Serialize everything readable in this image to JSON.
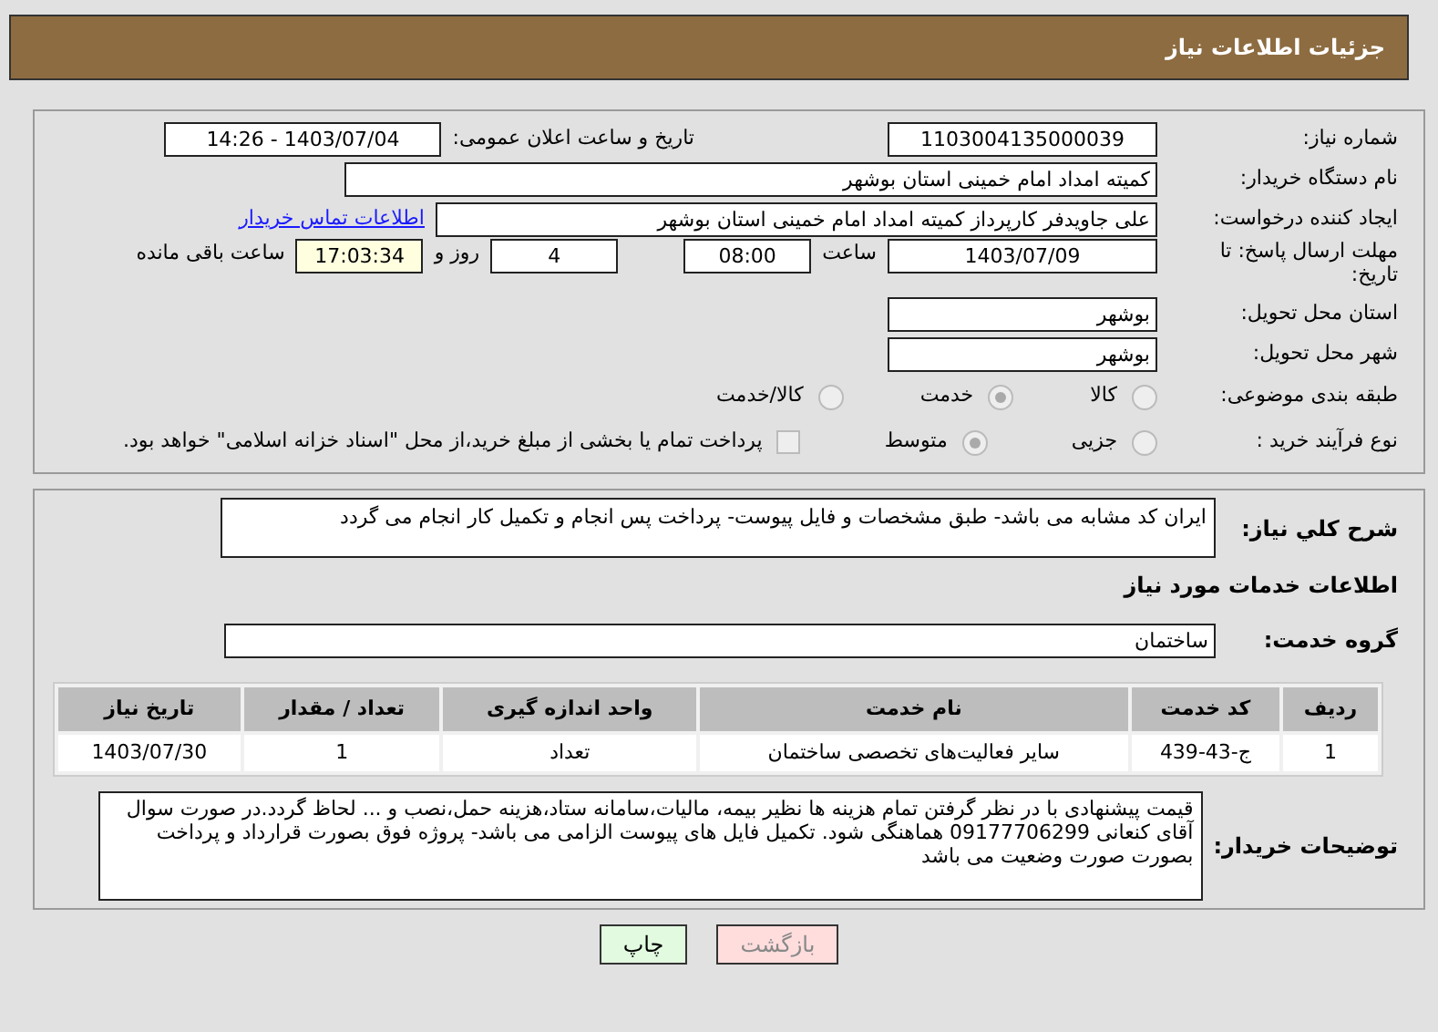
{
  "header": {
    "title": "جزئیات اطلاعات نیاز"
  },
  "need_number": {
    "label": "شماره نیاز:",
    "value": "1103004135000039"
  },
  "announce_date": {
    "label": "تاریخ و ساعت اعلان عمومی:",
    "value": "1403/07/04 - 14:26"
  },
  "buyer_org": {
    "label": "نام دستگاه خریدار:",
    "value": "کمیته امداد امام خمینی استان بوشهر"
  },
  "requester": {
    "label": "ایجاد کننده درخواست:",
    "value": "علی جاویدفر کارپرداز کمیته امداد امام خمینی استان بوشهر",
    "link": "اطلاعات تماس خریدار"
  },
  "deadline": {
    "label": "مهلت ارسال پاسخ: تا تاریخ:",
    "date": "1403/07/09",
    "time_label": "ساعت",
    "time": "08:00",
    "days": "4",
    "days_label": "روز و",
    "remaining": "17:03:34",
    "remaining_label": "ساعت باقی مانده"
  },
  "province": {
    "label": "استان محل تحویل:",
    "value": "بوشهر"
  },
  "city": {
    "label": "شهر محل تحویل:",
    "value": "بوشهر"
  },
  "category": {
    "label": "طبقه بندی موضوعی:",
    "disabled": true,
    "options": [
      {
        "label": "کالا",
        "selected": false
      },
      {
        "label": "خدمت",
        "selected": true
      },
      {
        "label": "کالا/خدمت",
        "selected": false
      }
    ]
  },
  "process": {
    "label": "نوع فرآیند خرید :",
    "disabled": true,
    "options": [
      {
        "label": "جزیی",
        "selected": false
      },
      {
        "label": "متوسط",
        "selected": true
      }
    ],
    "checkbox": {
      "label": "پرداخت تمام یا بخشی از مبلغ خرید،از محل \"اسناد خزانه اسلامی\" خواهد بود.",
      "checked": false
    }
  },
  "description": {
    "label": "شرح کلي نیاز:",
    "value": "ایران کد مشابه می باشد- طبق مشخصات و فایل پیوست- پرداخت پس انجام و تکمیل کار انجام می گردد"
  },
  "services_title": "اطلاعات خدمات مورد نیاز",
  "service_group": {
    "label": "گروه خدمت:",
    "value": "ساختمان"
  },
  "table": {
    "columns": [
      "ردیف",
      "کد خدمت",
      "نام خدمت",
      "واحد اندازه گیری",
      "تعداد / مقدار",
      "تاریخ نیاز"
    ],
    "rows": [
      [
        "1",
        "ج-43-439",
        "سایر فعالیت‌های تخصصی ساختمان",
        "تعداد",
        "1",
        "1403/07/30"
      ]
    ]
  },
  "buyer_notes": {
    "label": "توضیحات خریدار:",
    "value": "قیمت پیشنهادی با در نظر گرفتن تمام هزینه ها نظیر بیمه، مالیات،سامانه ستاد،هزینه حمل،نصب و ... لحاظ گردد.در صورت سوال آقای کنعانی 09177706299 هماهنگی شود. تکمیل فایل های پیوست الزامی می باشد- پروژه فوق بصورت قرارداد و پرداخت بصورت صورت وضعیت می باشد"
  },
  "buttons": [
    {
      "label": "بازگشت",
      "kind": "back"
    },
    {
      "label": "چاپ",
      "kind": "print"
    }
  ]
}
